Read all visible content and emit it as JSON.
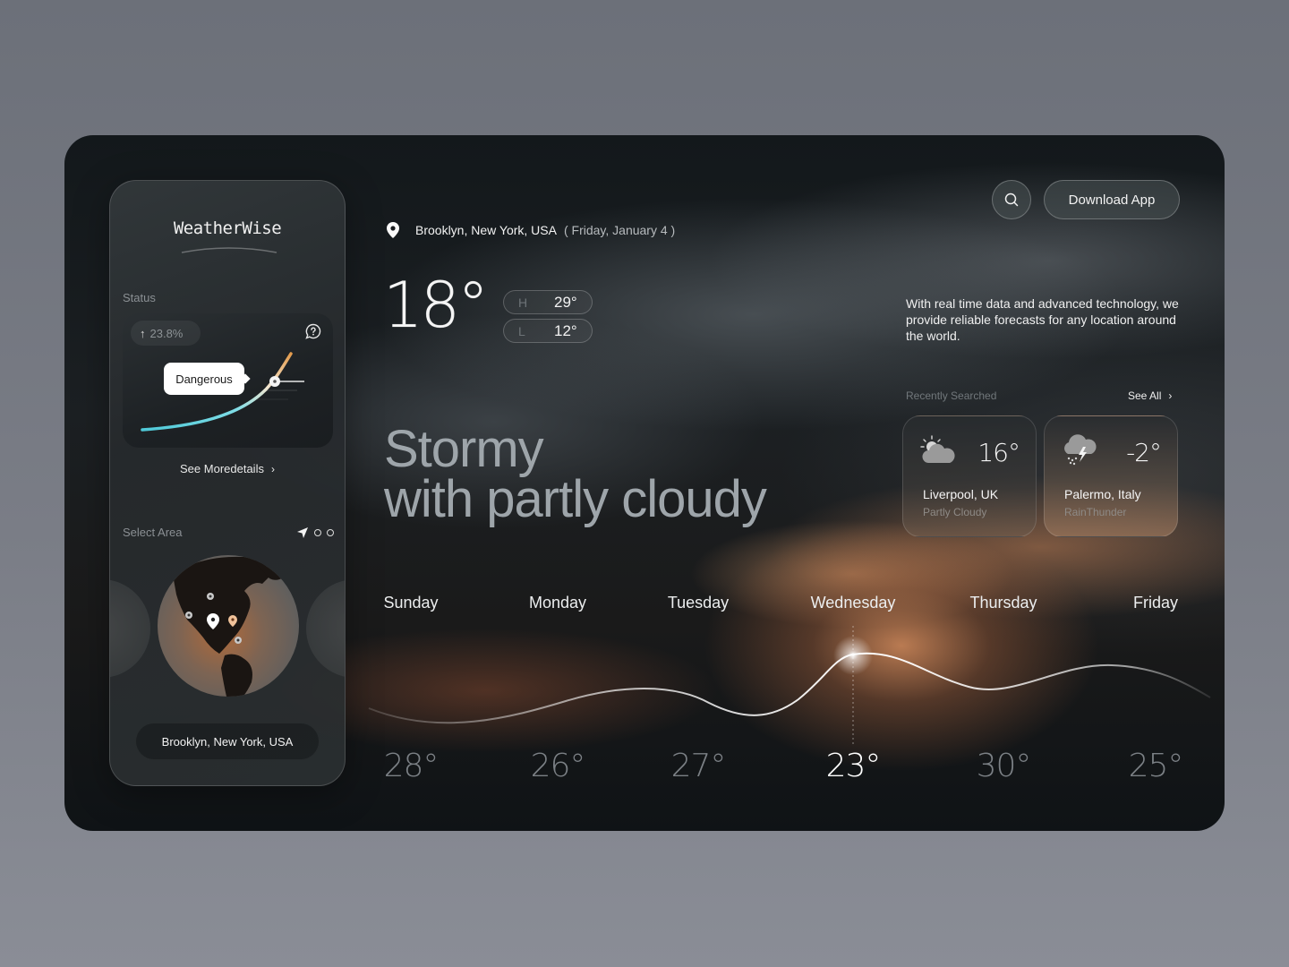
{
  "app": {
    "brand": "WeatherWise"
  },
  "sidebar": {
    "status_label": "Status",
    "status_change": "23.8%",
    "status_direction_icon": "arrow-up-icon",
    "status_level": "Dangerous",
    "help_icon": "help-bubble-icon",
    "see_more_label": "See Moredetails",
    "select_area_label": "Select Area",
    "selected_location": "Brooklyn, New York, USA"
  },
  "header": {
    "location": "Brooklyn, New York, USA",
    "date": "( Friday, January 4 )",
    "download_label": "Download App"
  },
  "current": {
    "temperature": "18°",
    "high_label": "H",
    "high_value": "29°",
    "low_label": "L",
    "low_value": "12°",
    "headline_line1": "Stormy",
    "headline_line2": "with partly cloudy"
  },
  "info": {
    "tagline": "With real time data and advanced technology, we provide reliable forecasts for any location around the world."
  },
  "recent": {
    "label": "Recently Searched",
    "see_all_label": "See All",
    "items": [
      {
        "city": "Liverpool, UK",
        "temperature": "16°",
        "condition": "Partly Cloudy",
        "icon": "partly-cloudy-icon"
      },
      {
        "city": "Palermo, Italy",
        "temperature": "-2°",
        "condition": "RainThunder",
        "icon": "rain-thunder-icon"
      }
    ]
  },
  "forecast": {
    "active_index": 3,
    "days": [
      {
        "day": "Sunday",
        "temperature": "28°",
        "value": 28
      },
      {
        "day": "Monday",
        "temperature": "26°",
        "value": 26
      },
      {
        "day": "Tuesday",
        "temperature": "27°",
        "value": 27
      },
      {
        "day": "Wednesday",
        "temperature": "23°",
        "value": 23
      },
      {
        "day": "Thursday",
        "temperature": "30°",
        "value": 30
      },
      {
        "day": "Friday",
        "temperature": "25°",
        "value": 25
      }
    ]
  },
  "colors": {
    "accent_cool": "#5fd3e0",
    "accent_warm": "#e8a55c",
    "card_dark": "#13181b"
  }
}
